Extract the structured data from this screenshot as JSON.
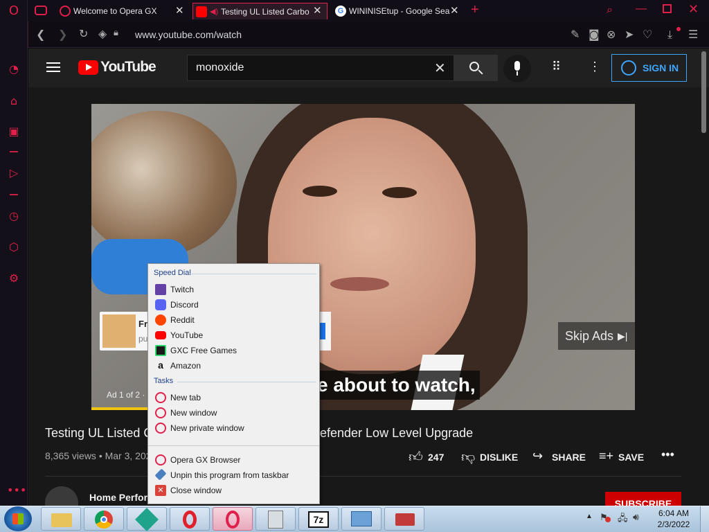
{
  "browser": {
    "tabs": [
      {
        "title": "Welcome to Opera GX"
      },
      {
        "title": "Testing UL Listed Carbo"
      },
      {
        "title": "WININISEtup - Google Sea"
      }
    ],
    "url": "www.youtube.com/watch"
  },
  "youtube": {
    "logo_text": "YouTube",
    "search_value": "monoxide",
    "signin_label": "SIGN IN",
    "skip_label": "Skip Ads",
    "caption": "e about to watch,",
    "ad_counter": "Ad 1 of 2 ·",
    "ad_card_text": "Fr",
    "ad_card_sub": "pu",
    "video_title_left": "Testing UL Listed C",
    "video_title_right": "efender Low Level Upgrade",
    "views": "8,365 views • Mar 3, 202",
    "like_count": "247",
    "dislike_label": "DISLIKE",
    "share_label": "SHARE",
    "save_label": "SAVE",
    "channel_name": "Home Perforr",
    "subscribe_label": "SUBSCRIBE"
  },
  "jumplist": {
    "speed_dial_header": "Speed Dial",
    "speed_dial": [
      {
        "label": "Twitch",
        "color": "#6441a5"
      },
      {
        "label": "Discord",
        "color": "#5865f2"
      },
      {
        "label": "Reddit",
        "color": "#ff4500"
      },
      {
        "label": "YouTube",
        "color": "#ff0000"
      },
      {
        "label": "GXC Free Games",
        "color": "#2bd66b"
      },
      {
        "label": "Amazon",
        "color": "#222222"
      }
    ],
    "tasks_header": "Tasks",
    "tasks": [
      {
        "label": "New tab"
      },
      {
        "label": "New window"
      },
      {
        "label": "New private window"
      }
    ],
    "footer": [
      {
        "label": "Opera GX Browser"
      },
      {
        "label": "Unpin this program from taskbar"
      },
      {
        "label": "Close window"
      }
    ]
  },
  "taskbar": {
    "time": "6:04 AM",
    "date": "2/3/2022",
    "seven_zip_label": "7z"
  },
  "colors": {
    "opera_accent": "#e0204a",
    "youtube_red": "#ff0000",
    "signin_blue": "#3ea6ff"
  }
}
